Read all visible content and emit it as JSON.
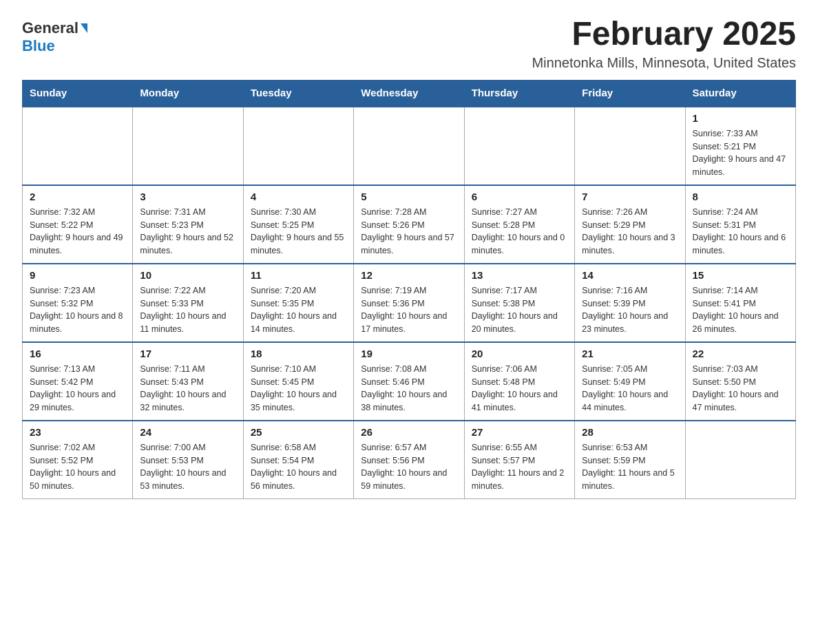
{
  "header": {
    "logo_general": "General",
    "logo_blue": "Blue",
    "main_title": "February 2025",
    "subtitle": "Minnetonka Mills, Minnesota, United States"
  },
  "calendar": {
    "days_of_week": [
      "Sunday",
      "Monday",
      "Tuesday",
      "Wednesday",
      "Thursday",
      "Friday",
      "Saturday"
    ],
    "weeks": [
      [
        {
          "day": "",
          "info": ""
        },
        {
          "day": "",
          "info": ""
        },
        {
          "day": "",
          "info": ""
        },
        {
          "day": "",
          "info": ""
        },
        {
          "day": "",
          "info": ""
        },
        {
          "day": "",
          "info": ""
        },
        {
          "day": "1",
          "info": "Sunrise: 7:33 AM\nSunset: 5:21 PM\nDaylight: 9 hours and 47 minutes."
        }
      ],
      [
        {
          "day": "2",
          "info": "Sunrise: 7:32 AM\nSunset: 5:22 PM\nDaylight: 9 hours and 49 minutes."
        },
        {
          "day": "3",
          "info": "Sunrise: 7:31 AM\nSunset: 5:23 PM\nDaylight: 9 hours and 52 minutes."
        },
        {
          "day": "4",
          "info": "Sunrise: 7:30 AM\nSunset: 5:25 PM\nDaylight: 9 hours and 55 minutes."
        },
        {
          "day": "5",
          "info": "Sunrise: 7:28 AM\nSunset: 5:26 PM\nDaylight: 9 hours and 57 minutes."
        },
        {
          "day": "6",
          "info": "Sunrise: 7:27 AM\nSunset: 5:28 PM\nDaylight: 10 hours and 0 minutes."
        },
        {
          "day": "7",
          "info": "Sunrise: 7:26 AM\nSunset: 5:29 PM\nDaylight: 10 hours and 3 minutes."
        },
        {
          "day": "8",
          "info": "Sunrise: 7:24 AM\nSunset: 5:31 PM\nDaylight: 10 hours and 6 minutes."
        }
      ],
      [
        {
          "day": "9",
          "info": "Sunrise: 7:23 AM\nSunset: 5:32 PM\nDaylight: 10 hours and 8 minutes."
        },
        {
          "day": "10",
          "info": "Sunrise: 7:22 AM\nSunset: 5:33 PM\nDaylight: 10 hours and 11 minutes."
        },
        {
          "day": "11",
          "info": "Sunrise: 7:20 AM\nSunset: 5:35 PM\nDaylight: 10 hours and 14 minutes."
        },
        {
          "day": "12",
          "info": "Sunrise: 7:19 AM\nSunset: 5:36 PM\nDaylight: 10 hours and 17 minutes."
        },
        {
          "day": "13",
          "info": "Sunrise: 7:17 AM\nSunset: 5:38 PM\nDaylight: 10 hours and 20 minutes."
        },
        {
          "day": "14",
          "info": "Sunrise: 7:16 AM\nSunset: 5:39 PM\nDaylight: 10 hours and 23 minutes."
        },
        {
          "day": "15",
          "info": "Sunrise: 7:14 AM\nSunset: 5:41 PM\nDaylight: 10 hours and 26 minutes."
        }
      ],
      [
        {
          "day": "16",
          "info": "Sunrise: 7:13 AM\nSunset: 5:42 PM\nDaylight: 10 hours and 29 minutes."
        },
        {
          "day": "17",
          "info": "Sunrise: 7:11 AM\nSunset: 5:43 PM\nDaylight: 10 hours and 32 minutes."
        },
        {
          "day": "18",
          "info": "Sunrise: 7:10 AM\nSunset: 5:45 PM\nDaylight: 10 hours and 35 minutes."
        },
        {
          "day": "19",
          "info": "Sunrise: 7:08 AM\nSunset: 5:46 PM\nDaylight: 10 hours and 38 minutes."
        },
        {
          "day": "20",
          "info": "Sunrise: 7:06 AM\nSunset: 5:48 PM\nDaylight: 10 hours and 41 minutes."
        },
        {
          "day": "21",
          "info": "Sunrise: 7:05 AM\nSunset: 5:49 PM\nDaylight: 10 hours and 44 minutes."
        },
        {
          "day": "22",
          "info": "Sunrise: 7:03 AM\nSunset: 5:50 PM\nDaylight: 10 hours and 47 minutes."
        }
      ],
      [
        {
          "day": "23",
          "info": "Sunrise: 7:02 AM\nSunset: 5:52 PM\nDaylight: 10 hours and 50 minutes."
        },
        {
          "day": "24",
          "info": "Sunrise: 7:00 AM\nSunset: 5:53 PM\nDaylight: 10 hours and 53 minutes."
        },
        {
          "day": "25",
          "info": "Sunrise: 6:58 AM\nSunset: 5:54 PM\nDaylight: 10 hours and 56 minutes."
        },
        {
          "day": "26",
          "info": "Sunrise: 6:57 AM\nSunset: 5:56 PM\nDaylight: 10 hours and 59 minutes."
        },
        {
          "day": "27",
          "info": "Sunrise: 6:55 AM\nSunset: 5:57 PM\nDaylight: 11 hours and 2 minutes."
        },
        {
          "day": "28",
          "info": "Sunrise: 6:53 AM\nSunset: 5:59 PM\nDaylight: 11 hours and 5 minutes."
        },
        {
          "day": "",
          "info": ""
        }
      ]
    ]
  }
}
